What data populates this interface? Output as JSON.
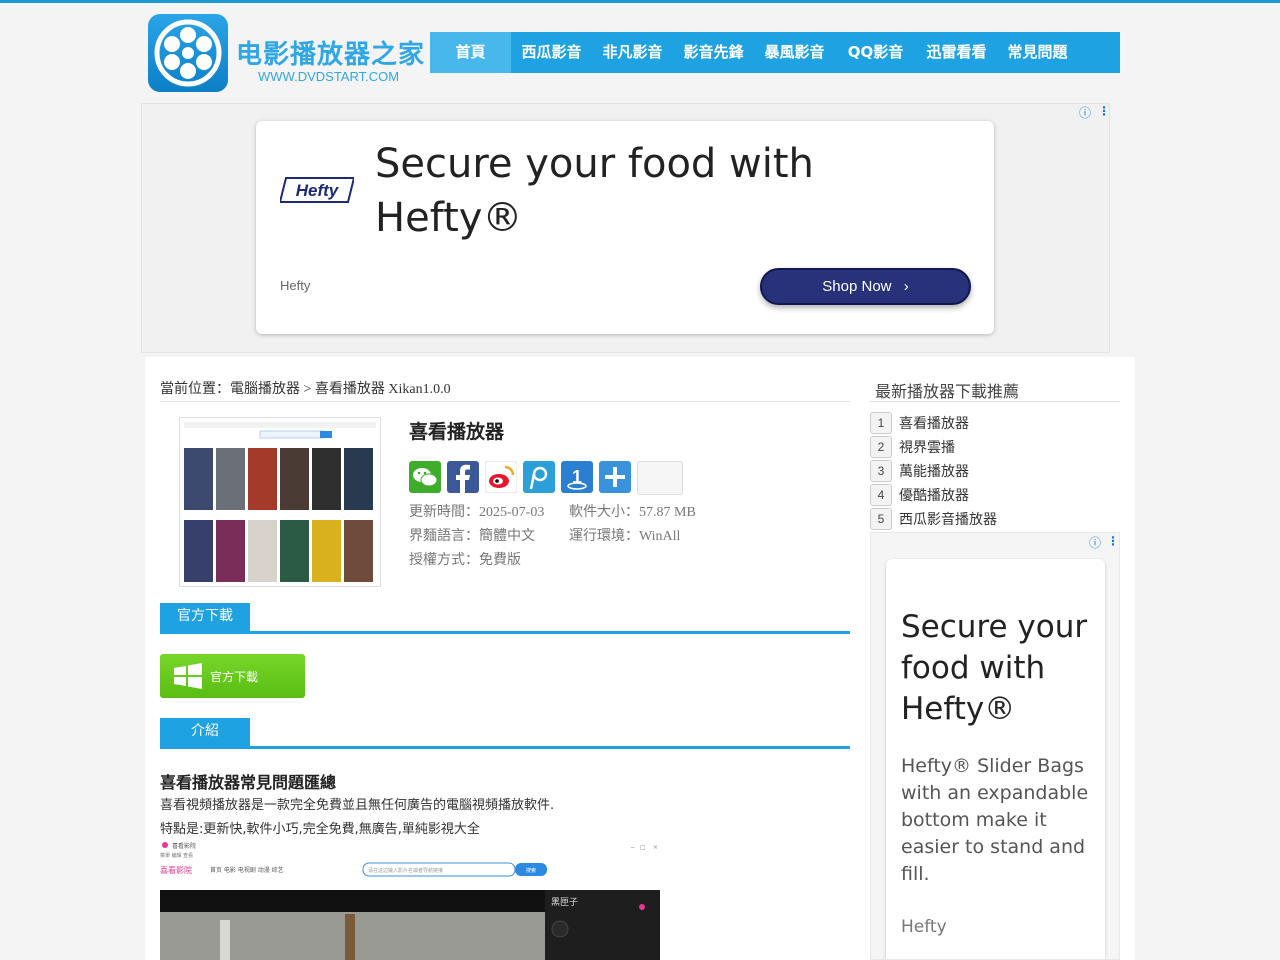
{
  "site": {
    "logo_title": "电影播放器之家",
    "logo_url_text": "WWW.DVDSTART.COM"
  },
  "nav": {
    "items": [
      {
        "label": "首頁",
        "active": true
      },
      {
        "label": "西瓜影音"
      },
      {
        "label": "非凡影音"
      },
      {
        "label": "影音先鋒"
      },
      {
        "label": "暴風影音"
      },
      {
        "label": "QQ影音"
      },
      {
        "label": "迅雷看看"
      },
      {
        "label": "常見問題"
      }
    ]
  },
  "ad_top": {
    "headline": "Secure your food with Hefty®",
    "logo_text": "Hefty",
    "brand": "Hefty",
    "button": "Shop Now",
    "info_icon": "ⓘ",
    "menu_icon": "⋮"
  },
  "breadcrumb": "當前位置：電腦播放器 > 喜看播放器 Xikan1.0.0",
  "product": {
    "title": "喜看播放器",
    "share_icons": [
      "wechat-icon",
      "facebook-icon",
      "weibo-icon",
      "tencent-weibo-icon",
      "renren-icon",
      "more-share-icon"
    ],
    "meta": {
      "updated": "更新時間：2025-07-03",
      "size": "軟件大小：57.87 MB",
      "language": "界麵語言：簡體中文",
      "env": "運行環境：WinAll",
      "license": "授權方式：免費版"
    }
  },
  "sections": {
    "download_tab": "官方下載",
    "download_button": "官方下載",
    "intro_tab": "介紹"
  },
  "article": {
    "faq_title": "喜看播放器常見問題匯總",
    "para1": "喜看視頻播放器是一款完全免費並且無任何廣告的電腦視頻播放軟件.",
    "para2": "特點是:更新快,軟件小巧,完全免費,無廣告,單純影視大全",
    "screenshot": {
      "app_name": "喜看影院",
      "app_menu": "菜單 编辑 查看",
      "tabs": "首页  电影  电视剧  动漫  综艺",
      "search_placeholder": "请在这边输入影片名或者导航链接",
      "search_button": "搜索",
      "panel_title": "黑匣子"
    }
  },
  "sidebar": {
    "title": "最新播放器下載推薦",
    "items": [
      {
        "num": "1",
        "label": "喜看播放器"
      },
      {
        "num": "2",
        "label": "視界雲播"
      },
      {
        "num": "3",
        "label": "萬能播放器"
      },
      {
        "num": "4",
        "label": "優酷播放器"
      },
      {
        "num": "5",
        "label": "西瓜影音播放器"
      }
    ]
  },
  "ad_side": {
    "headline": "Secure your food with Hefty®",
    "body": "Hefty® Slider Bags with an expandable bottom make it easier to stand and fill.",
    "brand": "Hefty",
    "info_icon": "ⓘ",
    "menu_icon": "⋮"
  },
  "colors": {
    "nav_bg": "#1fa2e2",
    "nav_active": "#48b8ec",
    "download_green": "#59bd13",
    "ad_button": "#27327a"
  }
}
